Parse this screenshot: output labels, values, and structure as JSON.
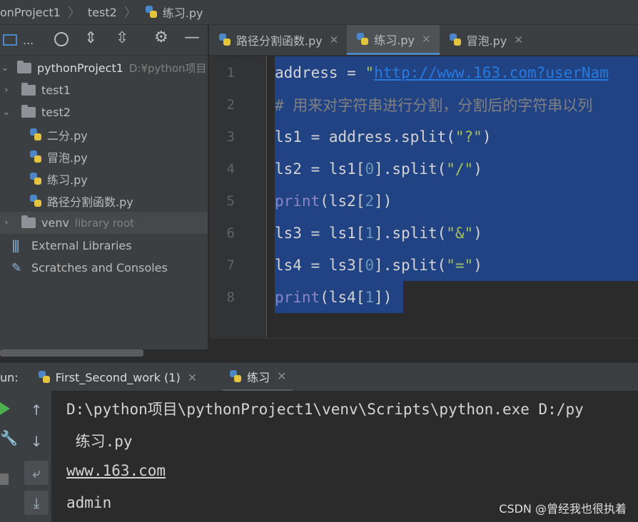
{
  "breadcrumb": [
    "onProject1",
    "test2",
    "练习.py"
  ],
  "project_panel": {
    "toolbar_label": "...",
    "tree": [
      {
        "label": "pythonProject1",
        "hint": "D:¥python项目¥",
        "level": 0,
        "expanded": true,
        "type": "project"
      },
      {
        "label": "test1",
        "level": 1,
        "expanded": false,
        "type": "folder"
      },
      {
        "label": "test2",
        "level": 1,
        "expanded": true,
        "type": "folder"
      },
      {
        "label": "二分.py",
        "level": 2,
        "type": "python-file"
      },
      {
        "label": "冒泡.py",
        "level": 2,
        "type": "python-file"
      },
      {
        "label": "练习.py",
        "level": 2,
        "type": "python-file"
      },
      {
        "label": "路径分割函数.py",
        "level": 2,
        "type": "python-file"
      },
      {
        "label": "venv",
        "hint": "library root",
        "level": 1,
        "expanded": false,
        "type": "folder"
      },
      {
        "label": "External Libraries",
        "level": 0,
        "type": "libraries"
      },
      {
        "label": "Scratches and Consoles",
        "level": 0,
        "type": "scratches"
      }
    ]
  },
  "editor_tabs": [
    {
      "label": "路径分割函数.py",
      "active": false
    },
    {
      "label": "练习.py",
      "active": true
    },
    {
      "label": "冒泡.py",
      "active": false
    }
  ],
  "editor": {
    "line_numbers": [
      "1",
      "2",
      "3",
      "4",
      "5",
      "6",
      "7",
      "8"
    ],
    "lines": {
      "l1_var": "address = ",
      "l1_q": "\"",
      "l1_url": "http://www.163.com?userNam",
      "l2": "# 用来对字符串进行分割，分割后的字符串以列",
      "l3_a": "ls1 = address.split(",
      "l3_s": "\"?\"",
      "l3_b": ")",
      "l4_a": "ls2 = ls1[",
      "l4_n": "0",
      "l4_b": "].split(",
      "l4_s": "\"/\"",
      "l4_c": ")",
      "l5_k": "print",
      "l5_a": "(ls2[",
      "l5_n": "2",
      "l5_b": "])",
      "l6_a": "ls3 = ls1[",
      "l6_n": "1",
      "l6_b": "].split(",
      "l6_s": "\"&\"",
      "l6_c": ")",
      "l7_a": "ls4 = ls3[",
      "l7_n": "0",
      "l7_b": "].split(",
      "l7_s": "\"=\"",
      "l7_c": ")",
      "l8_k": "print",
      "l8_a": "(ls4[",
      "l8_n": "1",
      "l8_b": "])"
    }
  },
  "run_panel": {
    "label": "un:",
    "tabs": [
      {
        "label": "First_Second_work (1)"
      },
      {
        "label": "练习"
      }
    ],
    "console": [
      "D:\\python项目\\pythonProject1\\venv\\Scripts\\python.exe D:/py",
      " 练习.py",
      "www.163.com",
      "admin"
    ]
  },
  "watermark": "CSDN @曾经我也很执着",
  "colors": {
    "selection": "#214283",
    "keyword": "#8888c6",
    "number": "#6897bb",
    "link": "#287bde",
    "accent_tab": "#4a88c7"
  }
}
